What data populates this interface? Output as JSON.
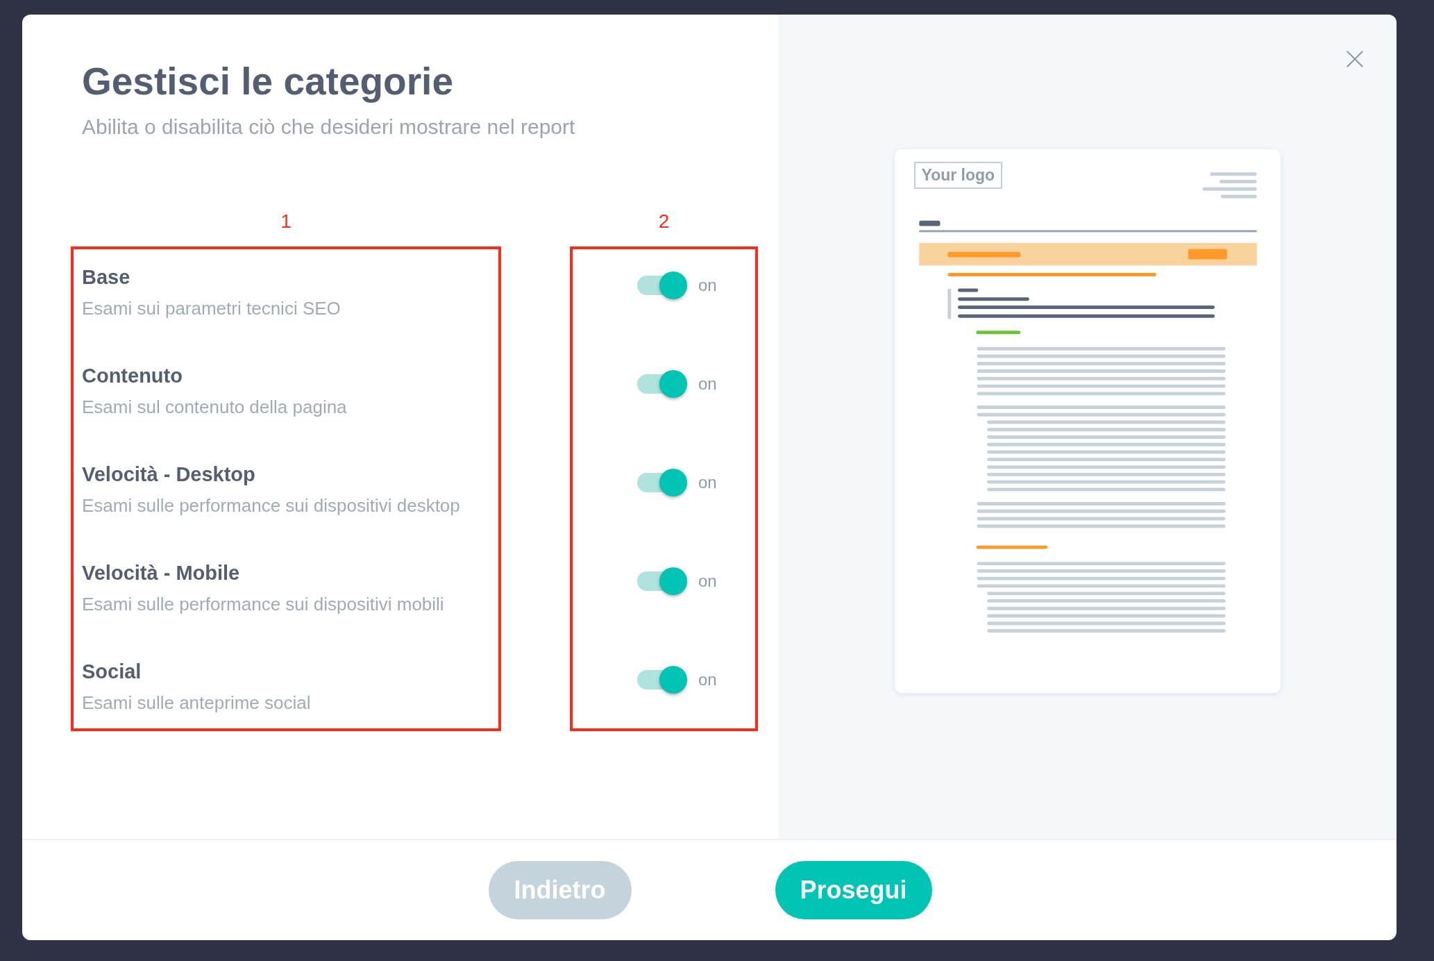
{
  "dialog": {
    "title": "Gestisci le categorie",
    "subtitle": "Abilita o disabilita ciò che desideri mostrare nel report",
    "column_labels": [
      "1",
      "2"
    ],
    "categories": [
      {
        "name": "Base",
        "description": "Esami sui parametri tecnici SEO",
        "on": true,
        "state_label": "on"
      },
      {
        "name": "Contenuto",
        "description": "Esami sul contenuto della pagina",
        "on": true,
        "state_label": "on"
      },
      {
        "name": "Velocità - Desktop",
        "description": "Esami sulle performance sui dispositivi desktop",
        "on": true,
        "state_label": "on"
      },
      {
        "name": "Velocità - Mobile",
        "description": "Esami sulle performance sui dispositivi mobili",
        "on": true,
        "state_label": "on"
      },
      {
        "name": "Social",
        "description": "Esami sulle anteprime social",
        "on": true,
        "state_label": "on"
      }
    ],
    "preview": {
      "logo": "Your logo"
    },
    "buttons": [
      {
        "label": "Indietro",
        "kind": "secondary"
      },
      {
        "label": "Prosegui",
        "kind": "primary"
      }
    ]
  }
}
